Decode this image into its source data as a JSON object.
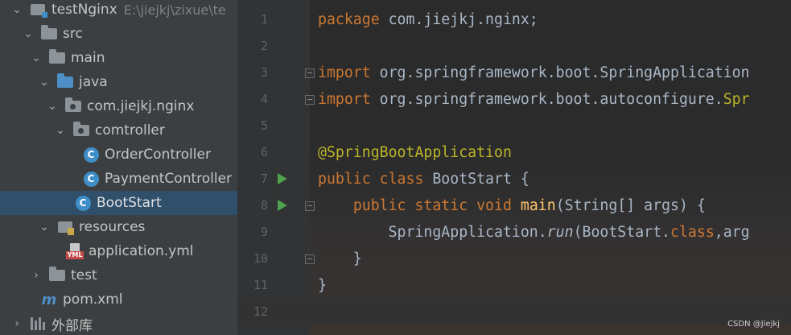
{
  "tree": {
    "project_name": "testNginx",
    "project_path": "E:\\jiejkj\\zixue\\te",
    "items": [
      {
        "label": "src"
      },
      {
        "label": "main"
      },
      {
        "label": "java"
      },
      {
        "label": "com.jiejkj.nginx"
      },
      {
        "label": "comtroller"
      },
      {
        "label": "OrderController"
      },
      {
        "label": "PaymentController"
      },
      {
        "label": "BootStart"
      },
      {
        "label": "resources"
      },
      {
        "label": "application.yml"
      },
      {
        "label": "test"
      },
      {
        "label": "pom.xml"
      },
      {
        "label": "外部库"
      }
    ],
    "class_icon_letter": "C",
    "maven_icon_letter": "m",
    "yml_icon_text": "YML"
  },
  "editor": {
    "line_numbers": [
      "1",
      "2",
      "3",
      "4",
      "5",
      "6",
      "7",
      "8",
      "9",
      "10",
      "11",
      "12"
    ],
    "code": {
      "l1_kw": "package",
      "l1_rest": " com.jiejkj.nginx;",
      "l3_kw": "import",
      "l3_rest": " org.springframework.boot.SpringApplication",
      "l4_kw": "import",
      "l4_rest": " org.springframework.boot.autoconfigure.",
      "l4_tail": "Spr",
      "l6_ann": "@SpringBootApplication",
      "l7_kw": "public class",
      "l7_rest": " BootStart {",
      "l8_indent": "    ",
      "l8_kw": "public static void",
      "l8_sp": " ",
      "l8_fn": "main",
      "l8_rest": "(String[] args) {",
      "l9_pre": "        SpringApplication.",
      "l9_it": "run",
      "l9_mid": "(BootStart.",
      "l9_kw": "class",
      "l9_rest": ",arg",
      "l10": "    }",
      "l11": "}"
    }
  },
  "watermark": "CSDN @Jiejkj"
}
